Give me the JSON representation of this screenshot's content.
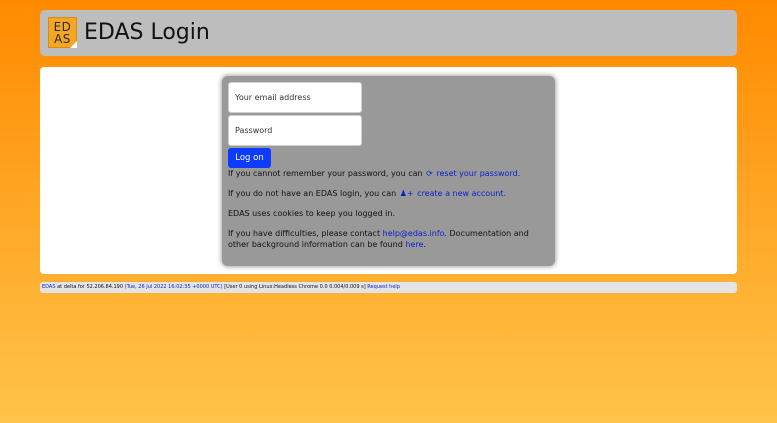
{
  "header": {
    "logo_top": "ED",
    "logo_bottom": "AS",
    "title": "EDAS Login"
  },
  "login": {
    "email_placeholder": "Your email address",
    "password_placeholder": "Password",
    "logon_label": "Log on",
    "forgot_prefix": "If you cannot remember your password, you can",
    "forgot_link": "reset your password.",
    "signup_prefix": "If you do not have an EDAS login, you can",
    "signup_link": "create a new account.",
    "cookies_text": "EDAS uses cookies to keep you logged in.",
    "help_prefix": "If you have difficulties, please contact",
    "help_email": "help@edas.info",
    "help_middle": ". Documentation and other background information can be found",
    "help_here": "here",
    "help_end": "."
  },
  "footer": {
    "edas_link": "EDAS",
    "at_text": "at delta for 52.206.84.190",
    "timestamp": "(Tue, 26 Jul 2022 16:02:35 +0000 UTC)",
    "user_info": "[User 0 using Linux:Headless Chrome 0.0 0.004/0.009 s]",
    "request_help": "Request help"
  },
  "colors": {
    "accent": "#0d3bff",
    "link": "#0a1fc9",
    "header_bg": "#bdbdbd",
    "panel_bg": "#999999"
  }
}
